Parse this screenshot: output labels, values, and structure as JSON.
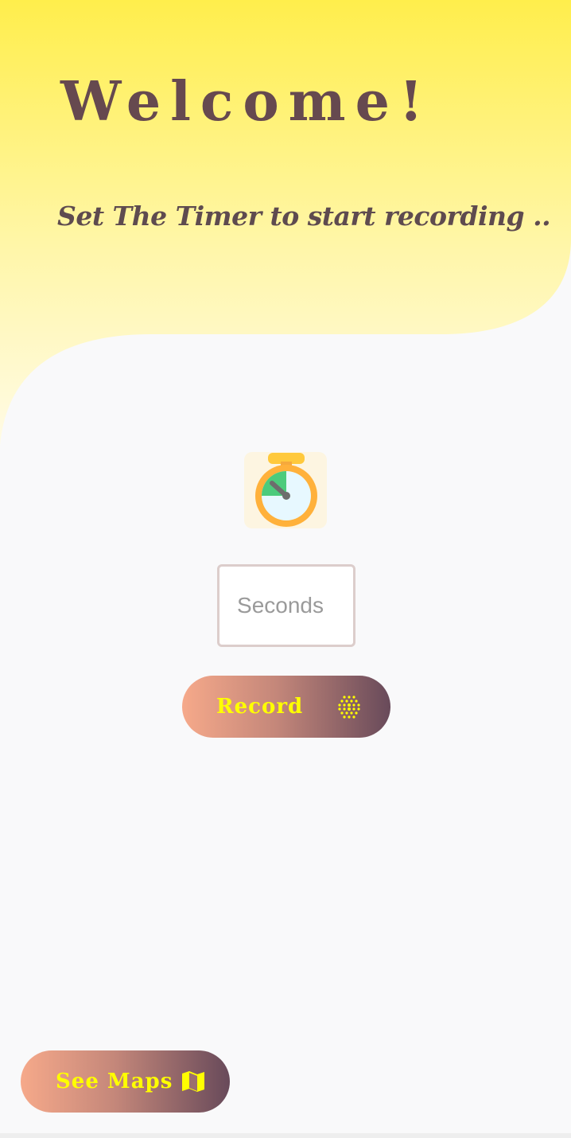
{
  "header": {
    "title": "Welcome!",
    "subtitle": "Set The Timer to start recording .."
  },
  "timer": {
    "icon": "stopwatch-icon",
    "input_placeholder": "Seconds",
    "input_value": ""
  },
  "record_button": {
    "label": "Record",
    "icon": "waveform-dots-icon"
  },
  "maps_button": {
    "label": "See Maps",
    "icon": "map-icon"
  },
  "colors": {
    "accent_yellow": "#ffef4f",
    "text_brown": "#66494f",
    "button_text": "#ffff00",
    "gradient_start": "#f6a98a",
    "gradient_end": "#684a5a"
  }
}
